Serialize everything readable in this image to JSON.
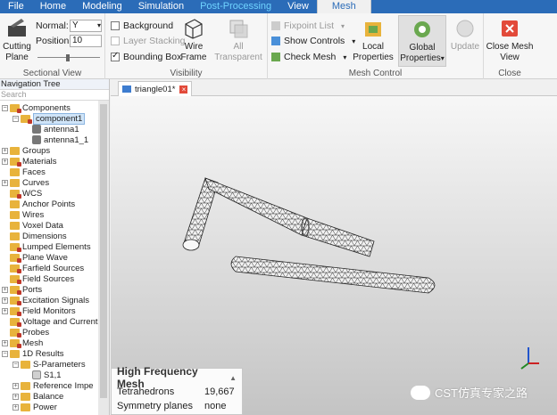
{
  "menu": {
    "tabs": [
      "File",
      "Home",
      "Modeling",
      "Simulation",
      "Post-Processing",
      "View",
      "Mesh"
    ],
    "active": "Mesh"
  },
  "ribbon": {
    "sectional_view": {
      "label": "Sectional View",
      "cutting_plane": "Cutting Plane",
      "normal_label": "Normal:",
      "normal_value": "Y",
      "position_label": "Position:",
      "position_value": "10"
    },
    "visibility": {
      "label": "Visibility",
      "background": "Background",
      "layer_stacking": "Layer Stacking",
      "bounding_box": "Bounding Box",
      "wire_frame": "Wire Frame",
      "all_transparent": "All Transparent"
    },
    "mesh_control": {
      "label": "Mesh Control",
      "fixpoint_list": "Fixpoint List",
      "show_controls": "Show Controls",
      "check_mesh": "Check Mesh",
      "local_properties": "Local Properties",
      "global_properties": "Global Properties",
      "update": "Update"
    },
    "close": {
      "label": "Close",
      "close_mesh_view": "Close Mesh View"
    }
  },
  "nav": {
    "title": "Navigation Tree",
    "search_placeholder": "Search",
    "items": [
      {
        "label": "Components",
        "expanded": true
      },
      {
        "label": "component1",
        "selected": true
      },
      {
        "label": "antenna1"
      },
      {
        "label": "antenna1_1"
      },
      {
        "label": "Groups"
      },
      {
        "label": "Materials"
      },
      {
        "label": "Faces"
      },
      {
        "label": "Curves"
      },
      {
        "label": "WCS"
      },
      {
        "label": "Anchor Points"
      },
      {
        "label": "Wires"
      },
      {
        "label": "Voxel Data"
      },
      {
        "label": "Dimensions"
      },
      {
        "label": "Lumped Elements"
      },
      {
        "label": "Plane Wave"
      },
      {
        "label": "Farfield Sources"
      },
      {
        "label": "Field Sources"
      },
      {
        "label": "Ports"
      },
      {
        "label": "Excitation Signals"
      },
      {
        "label": "Field Monitors"
      },
      {
        "label": "Voltage and Current"
      },
      {
        "label": "Probes"
      },
      {
        "label": "Mesh"
      },
      {
        "label": "1D Results"
      },
      {
        "label": "S-Parameters"
      },
      {
        "label": "S1,1"
      },
      {
        "label": "Reference Impe"
      },
      {
        "label": "Balance"
      },
      {
        "label": "Power"
      }
    ]
  },
  "document": {
    "tab_title": "triangle01*"
  },
  "info": {
    "title": "High Frequency Mesh",
    "rows": [
      {
        "key": "Tetrahedrons",
        "value": "19,667"
      },
      {
        "key": "Symmetry planes",
        "value": "none"
      }
    ]
  },
  "watermark": "CST仿真专家之路",
  "colors": {
    "menubar": "#2b6cb8",
    "post_processing": "#6fd3ff",
    "mesh_wire": "#222222",
    "mesh_face": "#f4f4f4"
  }
}
